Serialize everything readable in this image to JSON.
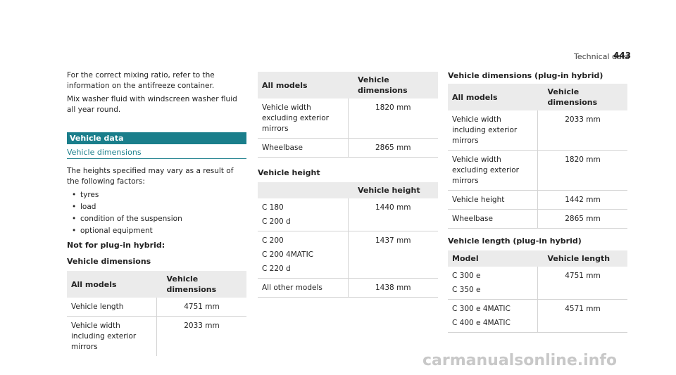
{
  "header": {
    "section_title": "Technical data",
    "page_number": "443"
  },
  "col1": {
    "para1": "For the correct mixing ratio, refer to the information on the antifreeze container.",
    "para2": "Mix washer fluid with windscreen washer fluid all year round.",
    "section_bar": "Vehicle data",
    "subheading": "Vehicle dimensions",
    "intro": "The heights specified may vary as a result of the following factors:",
    "bullets": [
      "tyres",
      "load",
      "condition of the suspension",
      "optional equipment"
    ],
    "not_plugin": "Not for plug-in hybrid:",
    "dims_title": "Vehicle dimensions",
    "table": {
      "headers": [
        "All models",
        "Vehicle dimensions"
      ],
      "rows": [
        {
          "label": "Vehicle length",
          "value": "4751 mm"
        },
        {
          "label": "Vehicle width including exterior mirrors",
          "value": "2033 mm"
        }
      ]
    }
  },
  "col2": {
    "table1": {
      "headers": [
        "All models",
        "Vehicle dimensions"
      ],
      "rows": [
        {
          "label": "Vehicle width excluding exterior mirrors",
          "value": "1820 mm"
        },
        {
          "label": "Wheelbase",
          "value": "2865 mm"
        }
      ]
    },
    "height_title": "Vehicle height",
    "table2": {
      "headers": [
        "",
        "Vehicle height"
      ],
      "rows": [
        {
          "labels": [
            "C 180",
            "C 200 d"
          ],
          "value": "1440 mm"
        },
        {
          "labels": [
            "C 200",
            "C 200 4MATIC",
            "C 220 d"
          ],
          "value": "1437 mm"
        },
        {
          "labels": [
            "All other models"
          ],
          "value": "1438 mm"
        }
      ]
    }
  },
  "col3": {
    "dims_title": "Vehicle dimensions (plug-in hybrid)",
    "table1": {
      "headers": [
        "All models",
        "Vehicle dimensions"
      ],
      "rows": [
        {
          "label": "Vehicle width including exterior mirrors",
          "value": "2033 mm"
        },
        {
          "label": "Vehicle width excluding exterior mirrors",
          "value": "1820 mm"
        },
        {
          "label": "Vehicle height",
          "value": "1442 mm"
        },
        {
          "label": "Wheelbase",
          "value": "2865 mm"
        }
      ]
    },
    "length_title": "Vehicle length (plug-in hybrid)",
    "table2": {
      "headers": [
        "Model",
        "Vehicle length"
      ],
      "rows": [
        {
          "labels": [
            "C 300 e",
            "C 350 e"
          ],
          "value": "4751 mm"
        },
        {
          "labels": [
            "C 300 e 4MATIC",
            "C 400 e 4MATIC"
          ],
          "value": "4571 mm"
        }
      ]
    }
  },
  "watermark": "carmanualsonline.info"
}
